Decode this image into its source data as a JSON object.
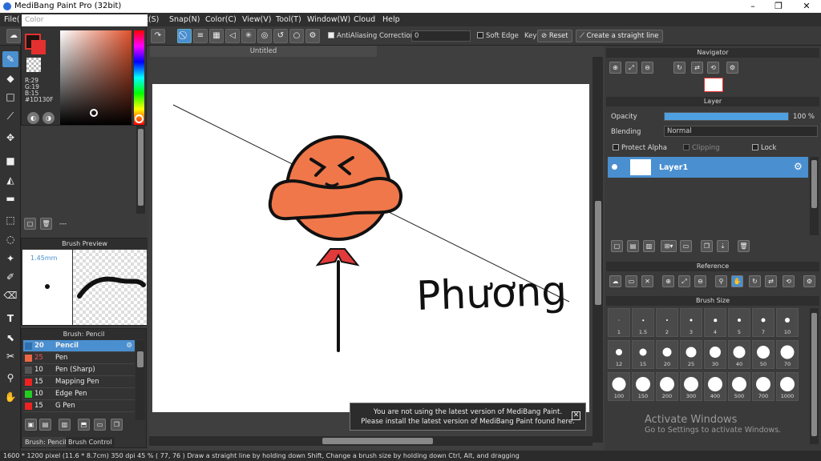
{
  "titlebar": {
    "title": "MediBang Paint Pro (32bit)",
    "minimize": "–",
    "maximize": "❐",
    "close": "✕"
  },
  "menu": [
    "File(",
    "ct(S)",
    "Snap(N)",
    "Color(C)",
    "View(V)",
    "Tool(T)",
    "Window(W)",
    "Cloud",
    "Help"
  ],
  "toolbar": {
    "antialiasing": "AntiAliasing",
    "correction_label": "Correction",
    "correction_value": "0",
    "soft_edge": "Soft Edge",
    "key_label": "Key",
    "reset": "Reset",
    "straight_line": "Create a straight line"
  },
  "color_panel": {
    "title": "Color",
    "fg_color": "#1D130F",
    "bg_color": "#e53030",
    "r": "R:29",
    "g": "G:19",
    "b": "B:15",
    "hex": "#1D130F"
  },
  "left_mid": {
    "dash": "---"
  },
  "brush_preview": {
    "title": "Brush Preview",
    "size": "1.45mm"
  },
  "brush_list": {
    "title": "Brush: Pencil",
    "items": [
      {
        "size": "20",
        "name": "Pencil",
        "color": "#4a8fd0",
        "selected": true
      },
      {
        "size": "25",
        "name": "Pen",
        "color": "#e64",
        "selected": false
      },
      {
        "size": "10",
        "name": "Pen (Sharp)",
        "color": "#555",
        "selected": false
      },
      {
        "size": "15",
        "name": "Mapping Pen",
        "color": "#e22",
        "selected": false
      },
      {
        "size": "10",
        "name": "Edge Pen",
        "color": "#2c2",
        "selected": false
      },
      {
        "size": "15",
        "name": "G Pen",
        "color": "#e22",
        "selected": false
      }
    ],
    "tab1": "Brush: Pencil",
    "tab2": "Brush Control"
  },
  "canvas": {
    "doc_title": "Untitled",
    "signature": "Phương"
  },
  "notification": {
    "line1": "You are not using the latest version of MediBang Paint.",
    "line2": "Please install the latest version of MediBang Paint found here.",
    "close": "✕"
  },
  "navigator": {
    "title": "Navigator"
  },
  "layer_panel": {
    "title": "Layer",
    "opacity_label": "Opacity",
    "opacity_value": "100 %",
    "opacity_pct": 100,
    "blending_label": "Blending",
    "blending_value": "Normal",
    "protect_alpha": "Protect Alpha",
    "clipping": "Clipping",
    "lock": "Lock",
    "layer_name": "Layer1"
  },
  "reference": {
    "title": "Reference"
  },
  "brush_size": {
    "title": "Brush Size",
    "sizes": [
      "1",
      "1.5",
      "2",
      "3",
      "4",
      "5",
      "7",
      "10",
      "12",
      "15",
      "20",
      "25",
      "30",
      "40",
      "50",
      "70",
      "100",
      "150",
      "200",
      "300",
      "400",
      "500",
      "700",
      "1000"
    ]
  },
  "watermark": {
    "line1": "Activate Windows",
    "line2": "Go to Settings to activate Windows."
  },
  "status": "1600 * 1200 pixel   (11.6 * 8.7cm)   350 dpi   45 %   ( 77, 76 )   Draw a straight line by holding down Shift, Change a brush size by holding down Ctrl, Alt, and dragging"
}
